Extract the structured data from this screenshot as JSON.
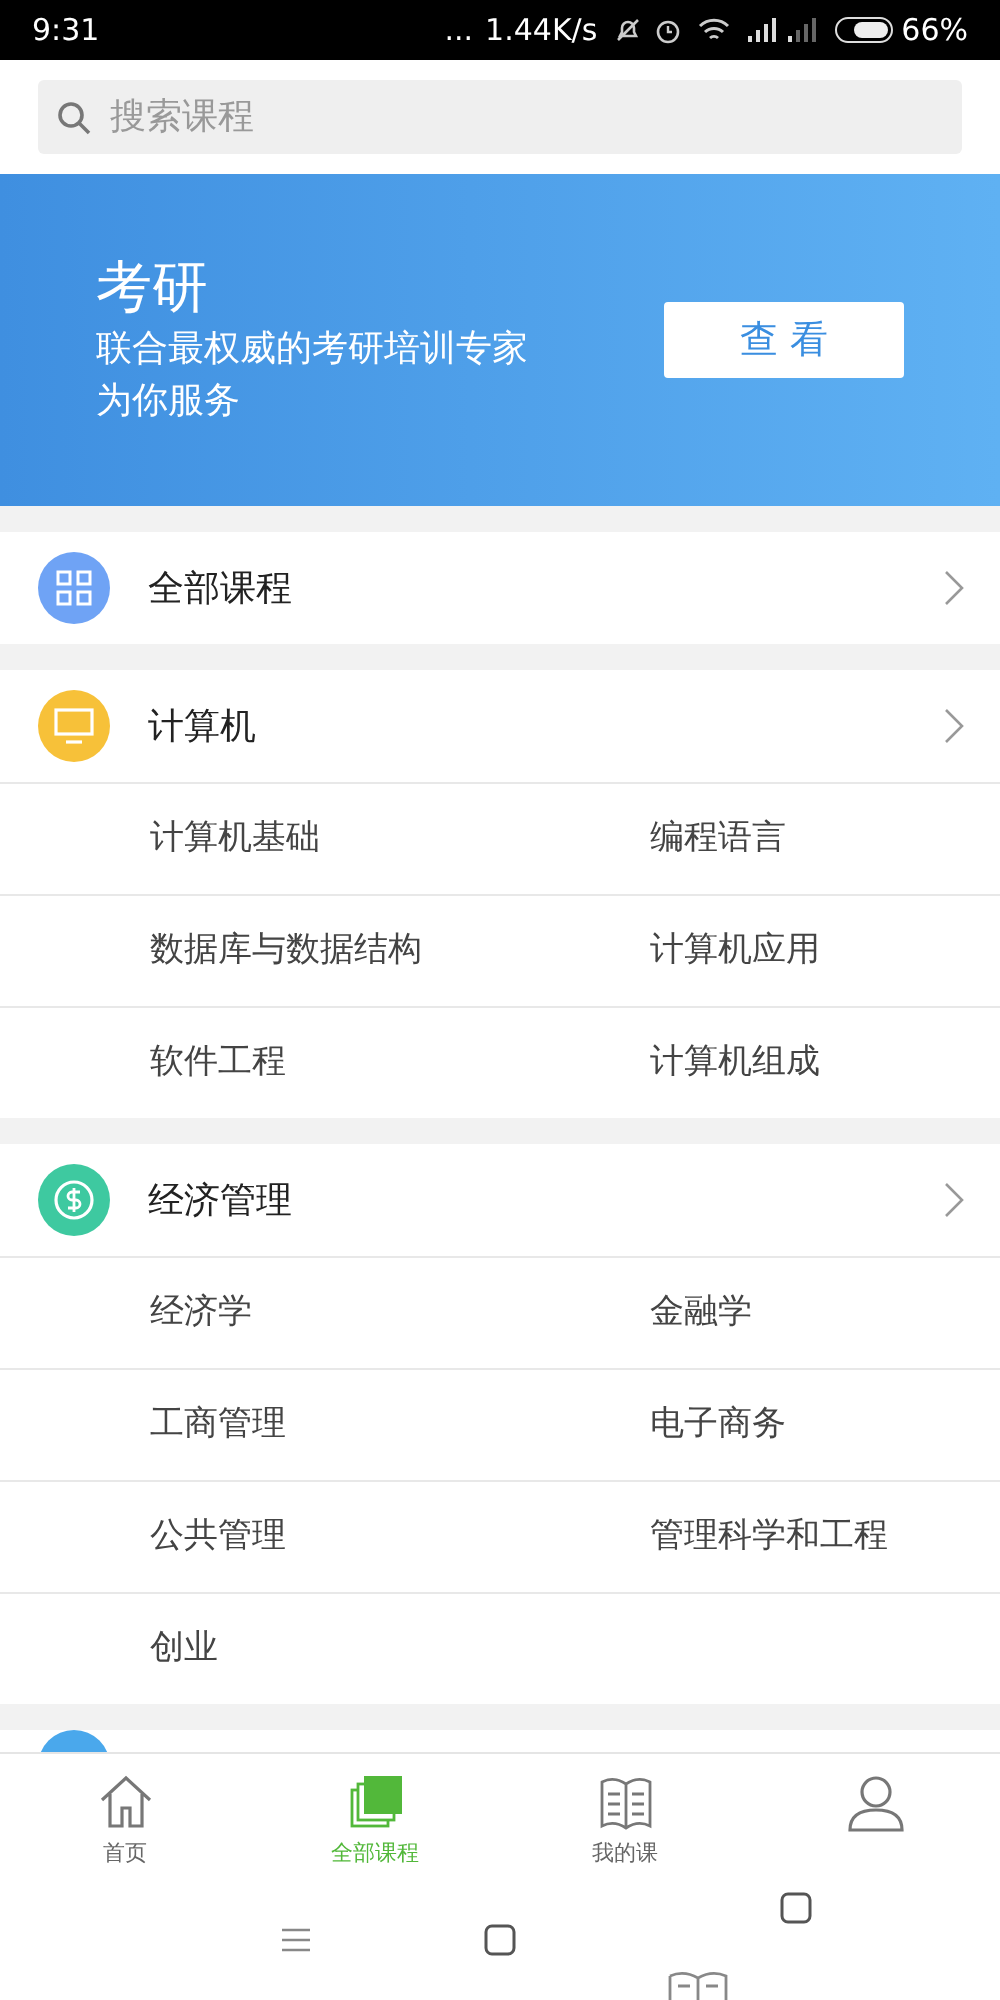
{
  "status_bar": {
    "time": "9:31",
    "dots": "...",
    "speed": "1.44K/s",
    "battery": "66%"
  },
  "search": {
    "placeholder": "搜索课程"
  },
  "banner": {
    "title": "考研",
    "subtitle_lines": [
      "联合最权威的考研培训专家",
      "为你服务"
    ],
    "button": "查 看"
  },
  "sections": [
    {
      "title": "全部课程",
      "color": "#6fa3f5"
    },
    {
      "title": "计算机",
      "color": "#f7c139",
      "items": [
        "计算机基础",
        "编程语言",
        "数据库与数据结构",
        "计算机应用",
        "软件工程",
        "计算机组成"
      ]
    },
    {
      "title": "经济管理",
      "color": "#3ec9a0",
      "items": [
        "经济学",
        "金融学",
        "工商管理",
        "电子商务",
        "公共管理",
        "管理科学和工程",
        "创业"
      ]
    }
  ],
  "tabs": [
    {
      "label": "首页",
      "selected": false
    },
    {
      "label": "全部课程",
      "selected": true
    },
    {
      "label": "我的课",
      "selected": false
    },
    {
      "selected": false
    }
  ]
}
